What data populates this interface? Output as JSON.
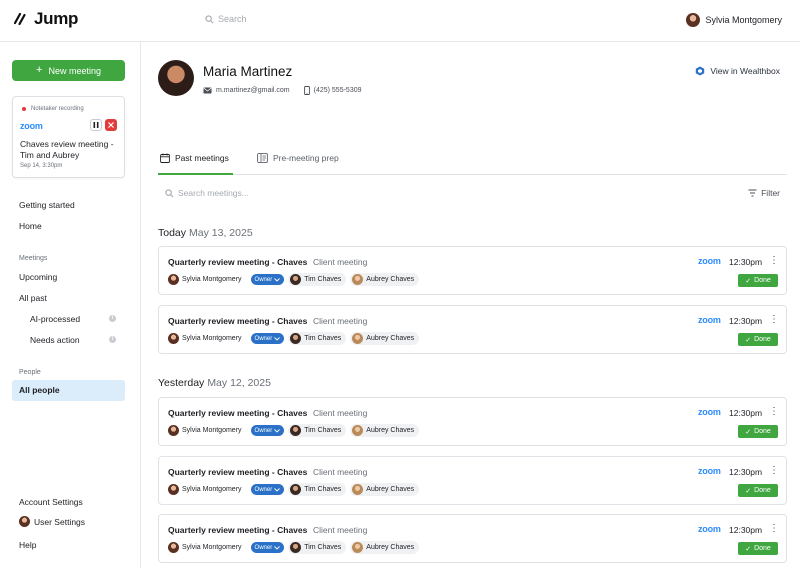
{
  "app": {
    "name": "Jump"
  },
  "topbar": {
    "search_placeholder": "Search",
    "user_name": "Sylvia Montgomery"
  },
  "sidebar": {
    "new_meeting": "New meeting",
    "recording": {
      "status": "Notetaker recording",
      "provider": "zoom",
      "title": "Chaves review meeting - Tim and Aubrey",
      "date": "Sep 14, 3:30pm"
    },
    "getting_started": "Getting started",
    "home": "Home",
    "meetings_section": "Meetings",
    "upcoming": "Upcoming",
    "all_past": "All past",
    "ai_processed": "AI-processed",
    "needs_action": "Needs action",
    "people_section": "People",
    "all_people": "All people",
    "account_settings": "Account Settings",
    "user_settings": "User Settings",
    "help": "Help"
  },
  "profile": {
    "name": "Maria Martinez",
    "email": "m.martinez@gmail.com",
    "phone": "(425) 555-5309",
    "view_link": "View in Wealthbox"
  },
  "tabs": {
    "past": "Past meetings",
    "prep": "Pre-meeting prep"
  },
  "list": {
    "search_placeholder": "Search meetings...",
    "filter": "Filter"
  },
  "groups": {
    "today": {
      "label": "Today",
      "date": "May 13, 2025"
    },
    "yesterday": {
      "label": "Yesterday",
      "date": "May 12, 2025"
    }
  },
  "meetings": [
    {
      "title": "Quarterly review meeting - Chaves",
      "type": "Client meeting",
      "host": "Sylvia Montgomery",
      "role": "Owner",
      "p1": "Tim Chaves",
      "p2": "Aubrey Chaves",
      "provider": "zoom",
      "time": "12:30pm",
      "status": "Done"
    },
    {
      "title": "Quarterly review meeting - Chaves",
      "type": "Client meeting",
      "host": "Sylvia Montgomery",
      "role": "Owner",
      "p1": "Tim Chaves",
      "p2": "Aubrey Chaves",
      "provider": "zoom",
      "time": "12:30pm",
      "status": "Done"
    },
    {
      "title": "Quarterly review meeting - Chaves",
      "type": "Client meeting",
      "host": "Sylvia Montgomery",
      "role": "Owner",
      "p1": "Tim Chaves",
      "p2": "Aubrey Chaves",
      "provider": "zoom",
      "time": "12:30pm",
      "status": "Done"
    },
    {
      "title": "Quarterly review meeting - Chaves",
      "type": "Client meeting",
      "host": "Sylvia Montgomery",
      "role": "Owner",
      "p1": "Tim Chaves",
      "p2": "Aubrey Chaves",
      "provider": "zoom",
      "time": "12:30pm",
      "status": "Done"
    },
    {
      "title": "Quarterly review meeting - Chaves",
      "type": "Client meeting",
      "host": "Sylvia Montgomery",
      "role": "Owner",
      "p1": "Tim Chaves",
      "p2": "Aubrey Chaves",
      "provider": "zoom",
      "time": "12:30pm",
      "status": "Done"
    }
  ],
  "colors": {
    "accent": "#3fa640",
    "owner_badge": "#2a71c7",
    "zoom": "#2d8cff",
    "active_nav": "#dbecfa",
    "recording": "#e23b3b"
  }
}
